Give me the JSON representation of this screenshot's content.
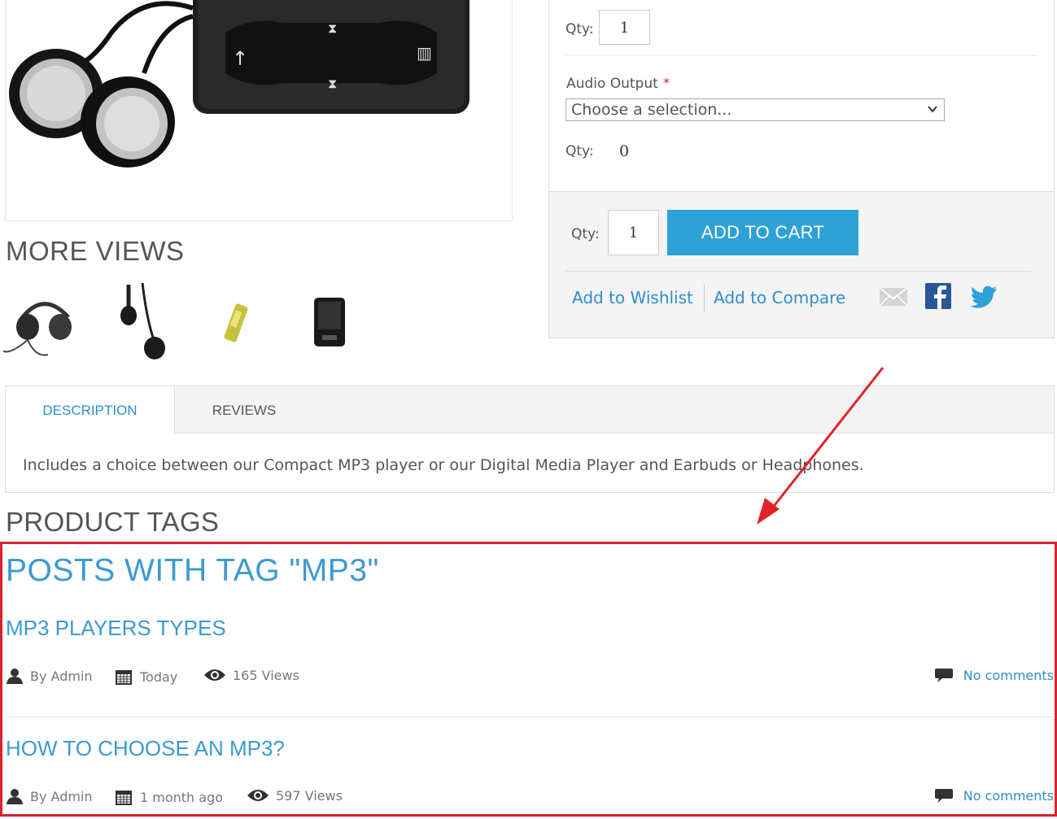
{
  "more_views": {
    "title": "MORE VIEWS"
  },
  "options": {
    "qty_label": "Qty:",
    "qty_value": "1",
    "audio_output_label": "Audio Output",
    "required_mark": "*",
    "select_value": "Choose a selection...",
    "qty2_label": "Qty:",
    "qty2_value": "0"
  },
  "cart": {
    "qty_label": "Qty:",
    "qty_value": "1",
    "add_to_cart": "ADD TO CART",
    "wishlist": "Add to Wishlist",
    "compare": "Add to Compare"
  },
  "tabs": {
    "description": "DESCRIPTION",
    "reviews": "REVIEWS",
    "content": "Includes a choice between our Compact MP3 player or our Digital Media Player and Earbuds or Headphones."
  },
  "product_tags": {
    "title": "PRODUCT TAGS"
  },
  "posts": {
    "heading": "POSTS WITH TAG \"MP3\"",
    "items": [
      {
        "title": "MP3 PLAYERS TYPES",
        "author": "By Admin",
        "date": "Today",
        "views": "165 Views",
        "comments": "No comments"
      },
      {
        "title": "HOW TO CHOOSE AN MP3?",
        "author": "By Admin",
        "date": "1 month ago",
        "views": "597 Views",
        "comments": "No comments"
      }
    ]
  },
  "colors": {
    "accent": "#2ea1d7",
    "link": "#2e8fc9",
    "highlight": "#d9232d"
  },
  "icons": [
    "email-icon",
    "facebook-icon",
    "twitter-icon",
    "user-icon",
    "calendar-icon",
    "eye-icon",
    "comment-icon"
  ]
}
